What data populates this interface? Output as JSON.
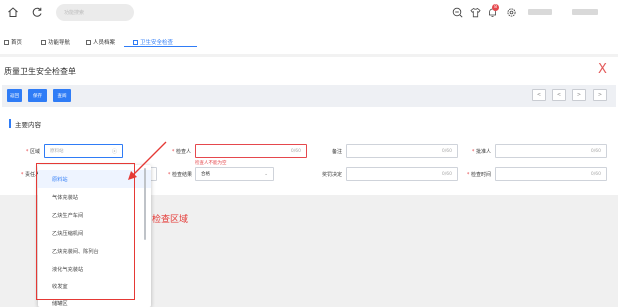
{
  "topbar": {
    "icons": [
      "home-icon",
      "refresh-icon",
      "zoom-icon",
      "shirt-icon",
      "bell-icon",
      "settings-icon"
    ],
    "search_placeholder": "功能搜索",
    "notification_count": "8"
  },
  "tabs": [
    {
      "label": "首页",
      "active": false
    },
    {
      "label": "功能导航",
      "active": false
    },
    {
      "label": "人员档案",
      "active": false
    },
    {
      "label": "卫生安全检查",
      "active": true
    }
  ],
  "page": {
    "title": "质量卫生安全检查单",
    "close_symbol": "X"
  },
  "toolbar": {
    "buttons": [
      "返回",
      "保存",
      "查阅"
    ],
    "pager": [
      "<",
      "<",
      ">",
      ">"
    ]
  },
  "section": {
    "title": "主要内容"
  },
  "form": {
    "region_label": "区域",
    "region_value": "原料站",
    "inspector_label": "检查人",
    "inspector_count": "0/60",
    "inspector_error": "检查人不能为空",
    "remark_label": "备注",
    "remark_count": "0/60",
    "approver_label": "批准人",
    "approver_count": "0/60",
    "responsible_label": "责任人",
    "responsible_count": "0/60",
    "result_label": "检查结果",
    "result_value": "合格",
    "punish_label": "奖罚决定",
    "punish_count": "0/60",
    "time_label": "检查时间",
    "time_count": "0/60"
  },
  "dropdown": {
    "items": [
      "原料站",
      "气体充装站",
      "乙炔生产车间",
      "乙炔压缩机间",
      "乙炔充装间、陈列台",
      "液化气充装站",
      "收发室",
      "储罐区"
    ],
    "selected_index": 0
  },
  "annotation": {
    "text": "检查区域"
  },
  "colors": {
    "accent": "#2f7cf6",
    "error": "#e5484d",
    "annotation": "#e53935"
  }
}
